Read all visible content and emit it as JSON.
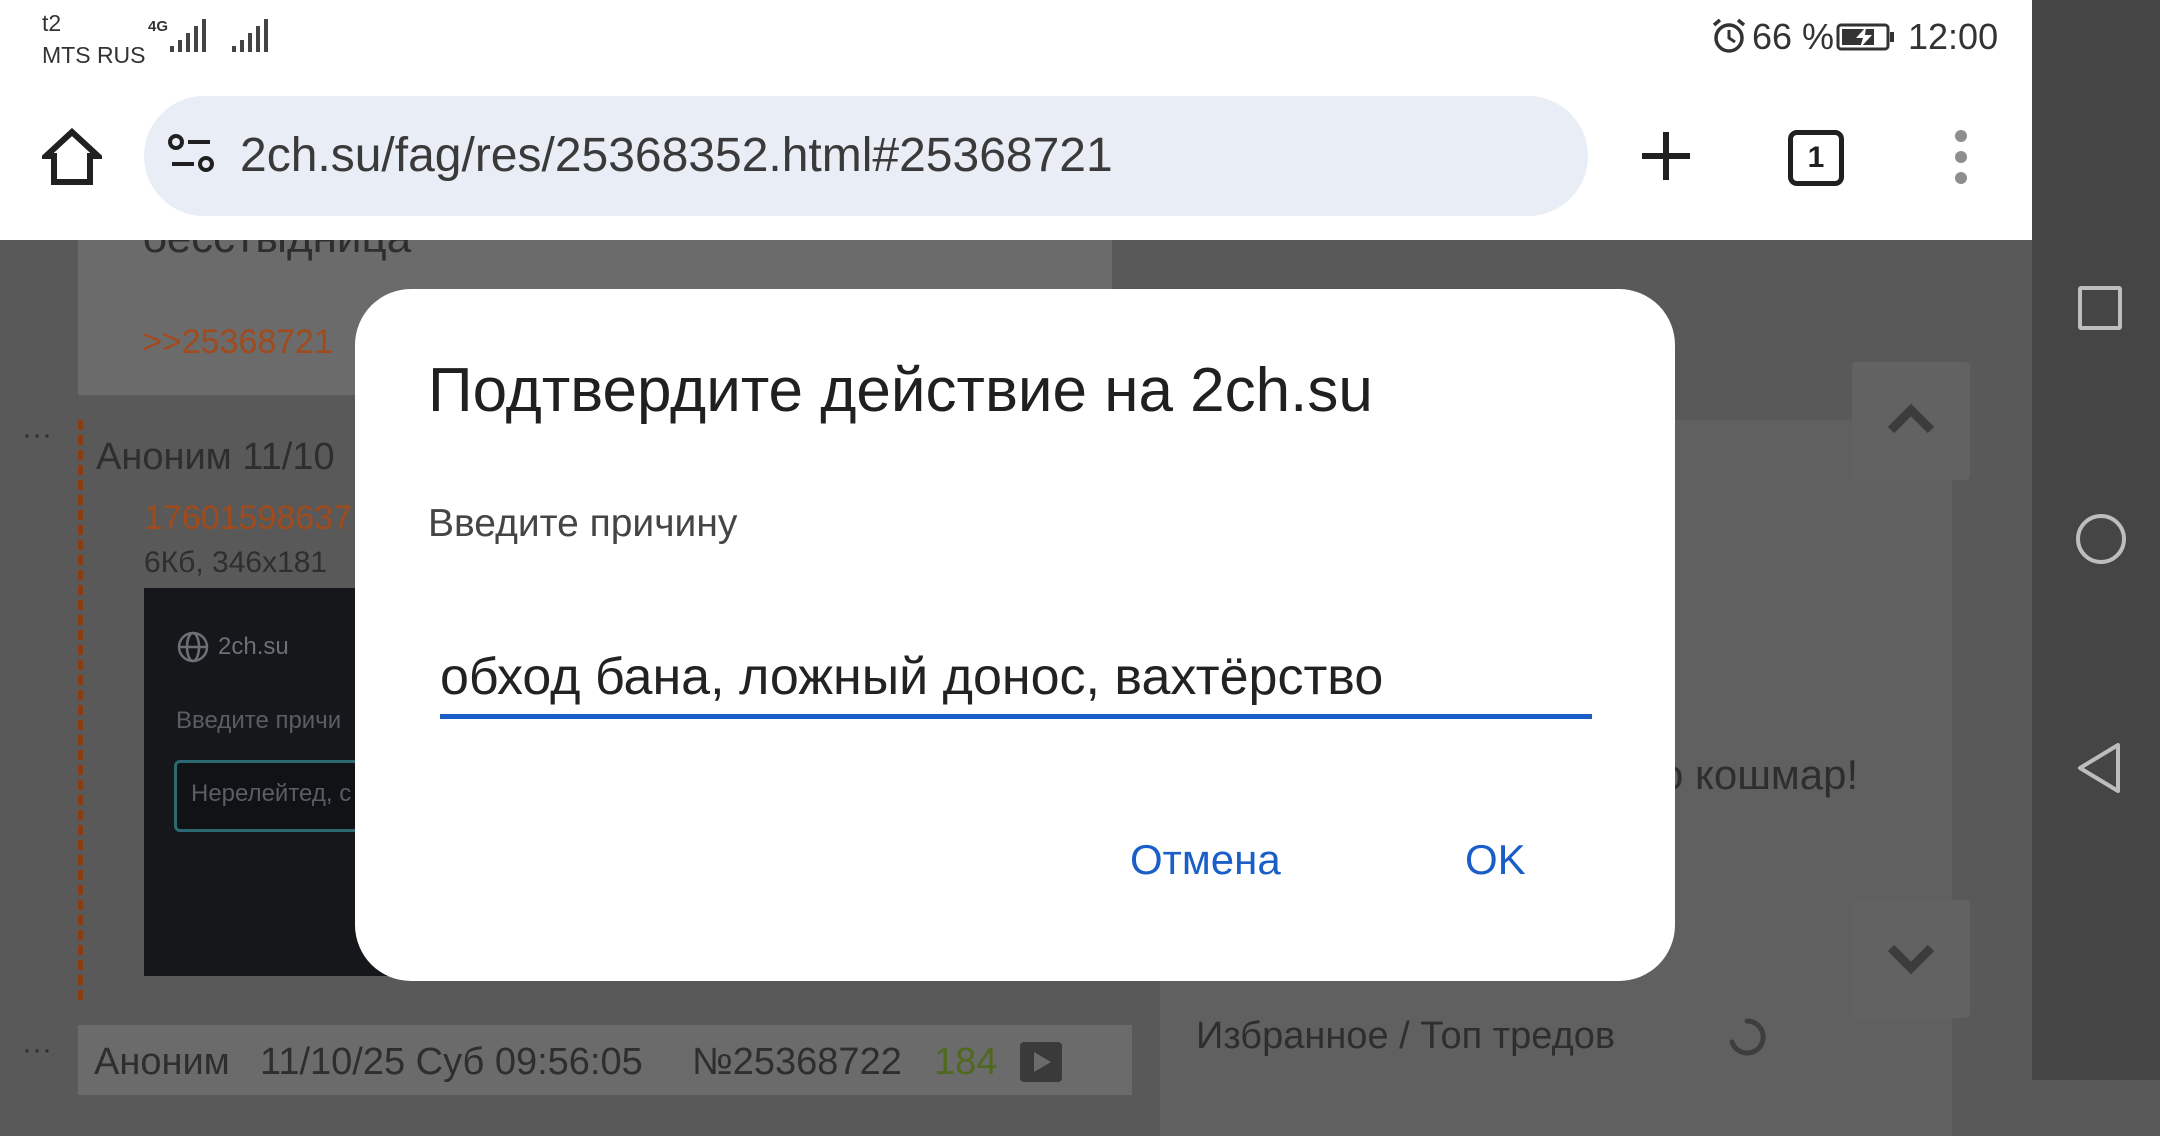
{
  "status_bar": {
    "carrier_top": "t2",
    "carrier_bottom": "MTS RUS",
    "network_type": "4G",
    "battery_percent": "66 %",
    "time": "12:00",
    "icons": [
      "signal-icon",
      "alarm-icon",
      "battery-charging-icon"
    ]
  },
  "browser": {
    "url": "2ch.su/fag/res/25368352.html#25368721",
    "tab_count": "1",
    "icons": [
      "home-icon",
      "site-settings-icon",
      "new-tab-icon",
      "tab-switcher-icon",
      "overflow-menu-icon"
    ]
  },
  "page": {
    "post1_text": "бесстыдница",
    "post1_reply_link": ">>25368721",
    "post2_header": "Аноним  11/10",
    "post2_file_name": "17601598637",
    "post2_file_meta": "6Кб, 346x181",
    "thumb_site": "2ch.su",
    "thumb_prompt": "Введите причи",
    "thumb_input": "Нерелейтед, с",
    "side_text": "о кошмар!",
    "post3_author": "Аноним",
    "post3_datetime": "11/10/25 Суб 09:56:05",
    "post3_number": "№25368722",
    "post3_replies": "184",
    "sidebar_title": "Избранное / Топ тредов",
    "menu_dots": "···"
  },
  "dialog": {
    "title": "Подтвердите действие на 2ch.su",
    "message": "Введите причину",
    "input_value": "обход бана, ложный донос, вахтёрство",
    "cancel_label": "Отмена",
    "ok_label": "OK"
  },
  "colors": {
    "accent": "#1a5fc7",
    "link_orange": "#a14a1c",
    "scrim": "#595959"
  }
}
